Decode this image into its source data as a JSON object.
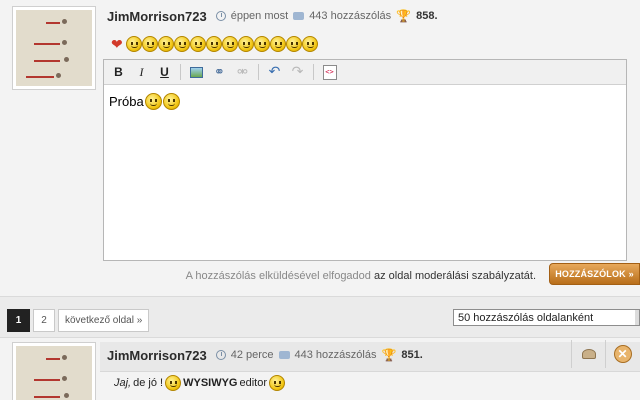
{
  "post1": {
    "username": "JimMorrison723",
    "time": "éppen most",
    "posts": "443 hozzászólás",
    "score": "858.",
    "smilies": [
      "heart",
      "grin",
      "laugh",
      "surprised",
      "smile",
      "neutral",
      "confused",
      "worried",
      "sad",
      "happy",
      "cry",
      "shocked",
      "wink"
    ],
    "editor": {
      "toolbar": {
        "bold": "B",
        "italic": "I",
        "underline": "U"
      },
      "content_text": "Próba",
      "content_smilies": [
        "confused",
        "happy"
      ]
    },
    "terms_prefix": "A hozzászólás elküldésével elfogadod",
    "terms_link": "az oldal moderálási szabályzatát.",
    "submit_label": "HOZZÁSZÓLOK »"
  },
  "pagination": {
    "pages": [
      "1",
      "2"
    ],
    "active": "1",
    "next_label": "következő oldal »",
    "per_page_selected": "50 hozzászólás oldalanként"
  },
  "post2": {
    "username": "JimMorrison723",
    "time": "42 perce",
    "posts": "443 hozzászólás",
    "score": "851.",
    "message": {
      "part1": "Jaj,",
      "part2": " de jó ! ",
      "part3": "WYSIWYG",
      "part4": " editor "
    }
  },
  "colors": {
    "accent_button": "#c9832e",
    "active_page": "#222222"
  }
}
